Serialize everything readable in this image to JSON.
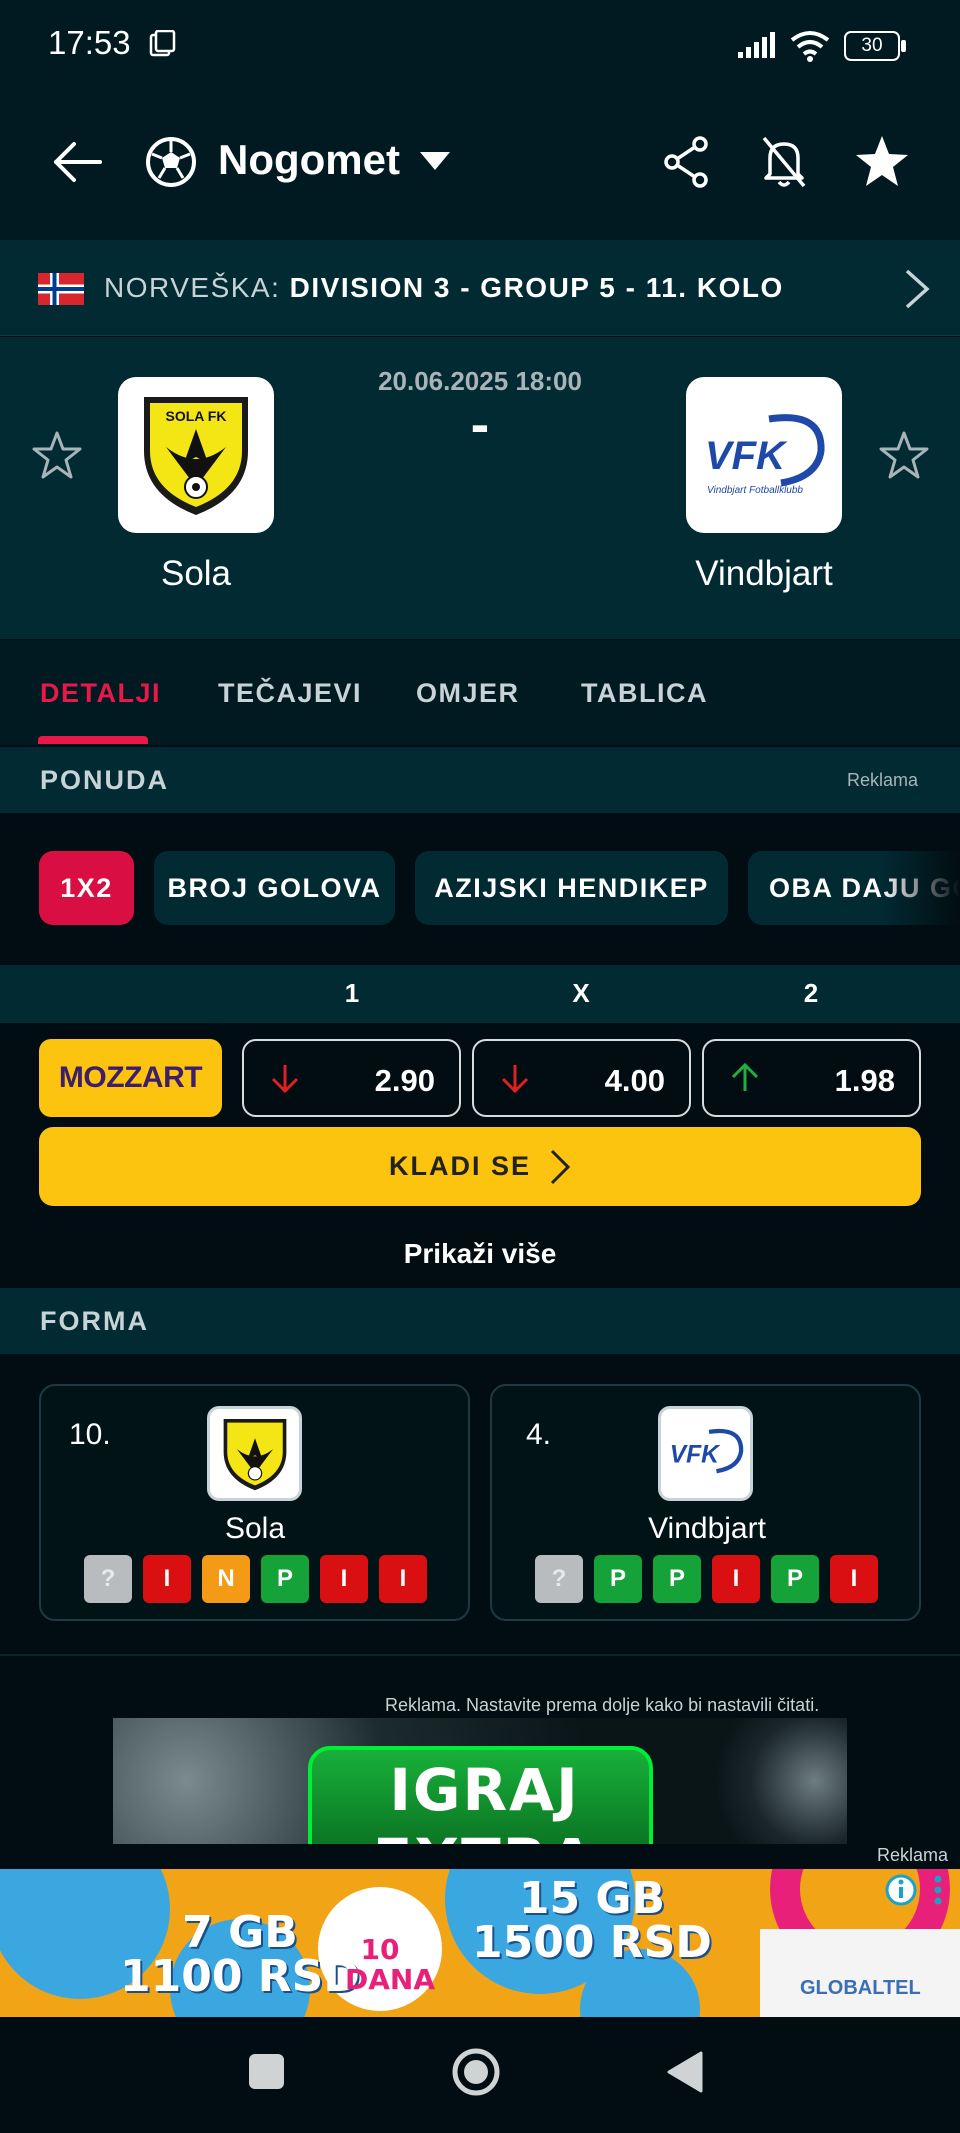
{
  "status_bar": {
    "time": "17:53",
    "battery": "30"
  },
  "header": {
    "sport": "Nogomet"
  },
  "league": {
    "country": "NORVEŠKA:",
    "name": "DIVISION 3 - GROUP 5 - 11. KOLO"
  },
  "match": {
    "datetime": "20.06.2025 18:00",
    "score": "-",
    "home": {
      "name": "Sola",
      "logo_text": "SOLA FK"
    },
    "away": {
      "name": "Vindbjart",
      "logo_text": "VFK",
      "logo_sub": "Vindbjart Fotballklubb"
    }
  },
  "tabs": [
    "DETALJI",
    "TEČAJEVI",
    "OMJER",
    "TABLICA"
  ],
  "ponuda": {
    "title": "PONUDA",
    "ad_label": "Reklama",
    "chips": [
      "1X2",
      "BROJ GOLOVA",
      "AZIJSKI HENDIKEP",
      "OBA DAJU GOL"
    ],
    "columns": [
      "1",
      "X",
      "2"
    ],
    "bookmaker": "MOZZART",
    "odds": [
      {
        "value": "2.90",
        "trend": "down"
      },
      {
        "value": "4.00",
        "trend": "down"
      },
      {
        "value": "1.98",
        "trend": "up"
      }
    ],
    "bet_button": "KLADI SE",
    "show_more": "Prikaži više"
  },
  "forma": {
    "title": "FORMA",
    "teams": [
      {
        "rank": "10.",
        "name": "Sola",
        "results": [
          "?",
          "I",
          "N",
          "P",
          "I",
          "I"
        ]
      },
      {
        "rank": "4.",
        "name": "Vindbjart",
        "results": [
          "?",
          "P",
          "P",
          "I",
          "P",
          "I"
        ]
      }
    ]
  },
  "ads": {
    "note": "Reklama. Nastavite prema dolje kako bi nastavili čitati.",
    "banner1_text": "IGRAJ",
    "banner1_text2": "EXTRA BET",
    "label": "Reklama",
    "banner2": {
      "left_gb": "7 GB",
      "left_price": "1100 RSD",
      "mid_days": "10",
      "mid_label": "DANA",
      "right_gb": "15 GB",
      "right_price": "1500 RSD",
      "brand": "GLOBALTEL"
    }
  },
  "colors": {
    "accent": "#e8194a",
    "yellow": "#fcc40e",
    "panel": "#022a33",
    "bg": "#010d12"
  }
}
